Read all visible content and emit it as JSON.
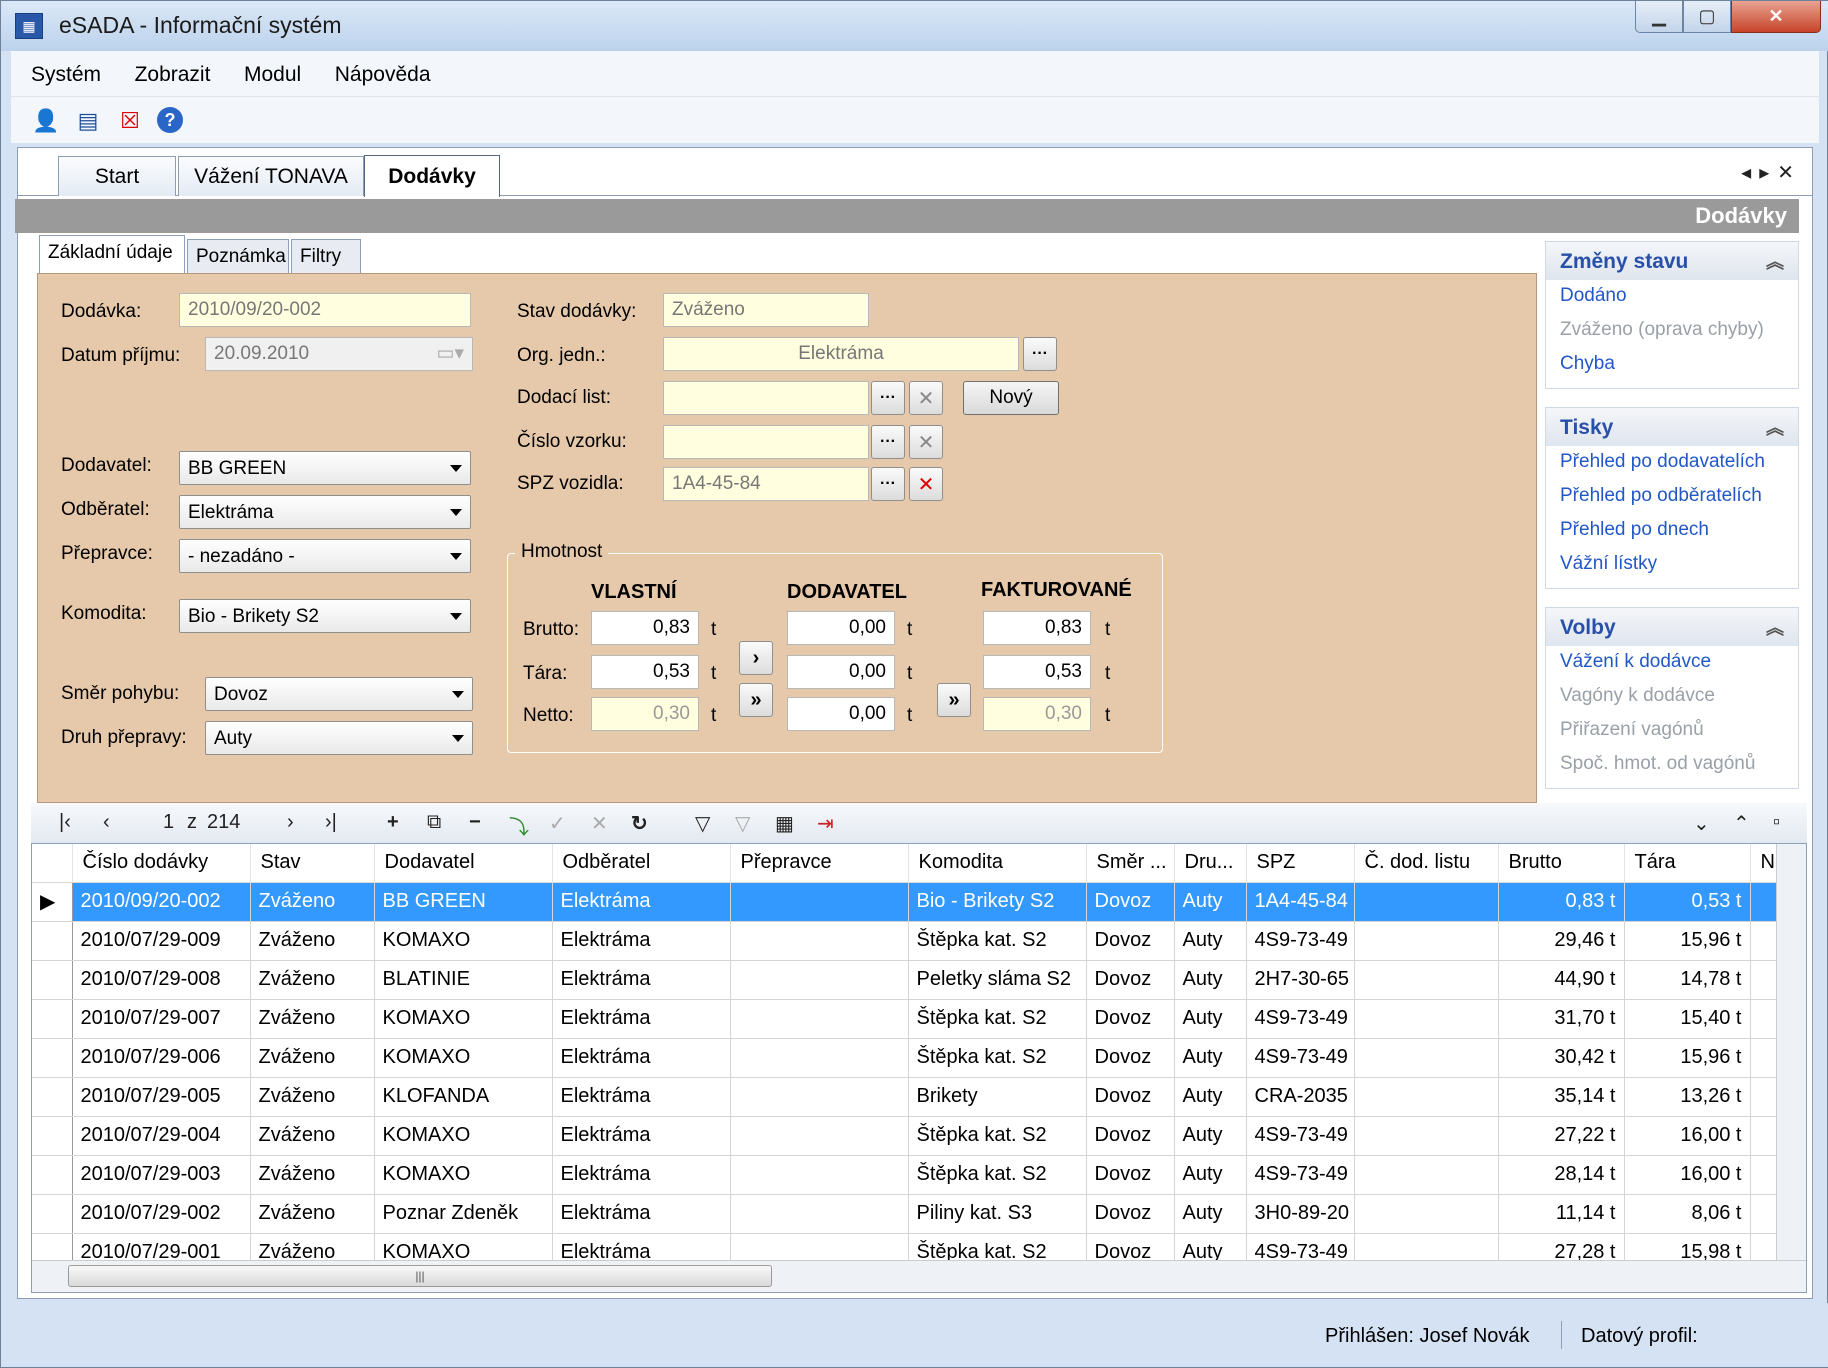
{
  "window": {
    "title": "eSADA - Informační systém",
    "app_icon": "building-icon"
  },
  "menu": [
    "Systém",
    "Zobrazit",
    "Modul",
    "Nápověda"
  ],
  "toolbar_icons": [
    "user-lock-icon",
    "window-icon",
    "close-window-icon",
    "help-icon"
  ],
  "doc_tabs": [
    "Start",
    "Vážení TONAVA",
    "Dodávky"
  ],
  "header_title": "Dodávky",
  "form_tabs": [
    "Základní údaje",
    "Poznámka",
    "Filtry"
  ],
  "form": {
    "dodavka_label": "Dodávka:",
    "dodavka_value": "2010/09/20-002",
    "datum_label": "Datum příjmu:",
    "datum_value": "20.09.2010",
    "dodavatel_label": "Dodavatel:",
    "dodavatel_value": "BB GREEN",
    "odberatel_label": "Odběratel:",
    "odberatel_value": "Elektráma",
    "prepravce_label": "Přepravce:",
    "prepravce_value": "- nezadáno -",
    "komodita_label": "Komodita:",
    "komodita_value": "Bio - Brikety S2",
    "smer_label": "Směr pohybu:",
    "smer_value": "Dovoz",
    "druh_label": "Druh přepravy:",
    "druh_value": "Auty",
    "stav_label": "Stav dodávky:",
    "stav_value": "Zváženo",
    "org_label": "Org. jedn.:",
    "org_value": "Elektráma",
    "dodaci_label": "Dodací list:",
    "dodaci_value": "",
    "novy_label": "Nový",
    "vzorek_label": "Číslo vzorku:",
    "vzorek_value": "",
    "spz_label": "SPZ vozidla:",
    "spz_value": "1A4-45-84"
  },
  "hmotnost": {
    "legend": "Hmotnost",
    "cols": [
      "VLASTNÍ",
      "DODAVATEL",
      "FAKTUROVANÉ"
    ],
    "rows": [
      "Brutto:",
      "Tára:",
      "Netto:"
    ],
    "unit": "t",
    "vlastni": [
      "0,83",
      "0,53",
      "0,30"
    ],
    "dodavatel": [
      "0,00",
      "0,00",
      "0,00"
    ],
    "fakturovane": [
      "0,83",
      "0,53",
      "0,30"
    ]
  },
  "side_panels": {
    "zmeny": {
      "title": "Změny stavu",
      "items": [
        "Dodáno",
        "Zváženo (oprava chyby)",
        "Chyba"
      ]
    },
    "tisky": {
      "title": "Tisky",
      "items": [
        "Přehled po dodavatelích",
        "Přehled po odběratelích",
        "Přehled po dnech",
        "Vážní lístky"
      ]
    },
    "volby": {
      "title": "Volby",
      "items": [
        "Vážení k dodávce",
        "Vagóny k dodávce",
        "Přiřazení vagónů",
        "Spoč. hmot. od vagónů"
      ]
    }
  },
  "navigator": {
    "position": "1",
    "of": "z",
    "total": "214"
  },
  "grid": {
    "columns": [
      "Číslo dodávky",
      "Stav",
      "Dodavatel",
      "Odběratel",
      "Přepravce",
      "Komodita",
      "Směr ...",
      "Dru...",
      "SPZ",
      "Č. dod. listu",
      "Brutto",
      "Tára",
      "N"
    ],
    "rows": [
      [
        "2010/09/20-002",
        "Zváženo",
        "BB GREEN",
        "Elektráma",
        "",
        "Bio - Brikety S2",
        "Dovoz",
        "Auty",
        "1A4-45-84",
        "",
        "0,83 t",
        "0,53 t"
      ],
      [
        "2010/07/29-009",
        "Zváženo",
        "KOMAXO",
        "Elektráma",
        "",
        "Štěpka kat. S2",
        "Dovoz",
        "Auty",
        "4S9-73-49",
        "",
        "29,46 t",
        "15,96 t"
      ],
      [
        "2010/07/29-008",
        "Zváženo",
        "BLATINIE",
        "Elektráma",
        "",
        "Peletky sláma S2",
        "Dovoz",
        "Auty",
        "2H7-30-65",
        "",
        "44,90 t",
        "14,78 t"
      ],
      [
        "2010/07/29-007",
        "Zváženo",
        "KOMAXO",
        "Elektráma",
        "",
        "Štěpka kat. S2",
        "Dovoz",
        "Auty",
        "4S9-73-49",
        "",
        "31,70 t",
        "15,40 t"
      ],
      [
        "2010/07/29-006",
        "Zváženo",
        "KOMAXO",
        "Elektráma",
        "",
        "Štěpka kat. S2",
        "Dovoz",
        "Auty",
        "4S9-73-49",
        "",
        "30,42 t",
        "15,96 t"
      ],
      [
        "2010/07/29-005",
        "Zváženo",
        "KLOFANDA",
        "Elektráma",
        "",
        "Brikety",
        "Dovoz",
        "Auty",
        "CRA-2035",
        "",
        "35,14 t",
        "13,26 t"
      ],
      [
        "2010/07/29-004",
        "Zváženo",
        "KOMAXO",
        "Elektráma",
        "",
        "Štěpka kat. S2",
        "Dovoz",
        "Auty",
        "4S9-73-49",
        "",
        "27,22 t",
        "16,00 t"
      ],
      [
        "2010/07/29-003",
        "Zváženo",
        "KOMAXO",
        "Elektráma",
        "",
        "Štěpka kat. S2",
        "Dovoz",
        "Auty",
        "4S9-73-49",
        "",
        "28,14 t",
        "16,00 t"
      ],
      [
        "2010/07/29-002",
        "Zváženo",
        "Poznar Zdeněk",
        "Elektráma",
        "",
        "Piliny kat. S3",
        "Dovoz",
        "Auty",
        "3H0-89-20",
        "",
        "11,14 t",
        "8,06 t"
      ],
      [
        "2010/07/29-001",
        "Zváženo",
        "KOMAXO",
        "Elektráma",
        "",
        "Štěpka kat. S2",
        "Dovoz",
        "Auty",
        "4S9-73-49",
        "",
        "27,28 t",
        "15,98 t"
      ]
    ]
  },
  "status": {
    "user": "Přihlášen: Josef Novák",
    "profile": "Datový profil:"
  }
}
